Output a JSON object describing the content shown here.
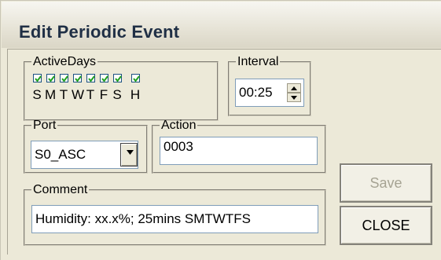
{
  "window": {
    "title": "Edit Periodic Event"
  },
  "active_days": {
    "legend": "ActiveDays",
    "days": [
      {
        "label": "S",
        "checked": true
      },
      {
        "label": "M",
        "checked": true
      },
      {
        "label": "T",
        "checked": true
      },
      {
        "label": "W",
        "checked": true
      },
      {
        "label": "T",
        "checked": true
      },
      {
        "label": "F",
        "checked": true
      },
      {
        "label": "S",
        "checked": true
      },
      {
        "label": "H",
        "checked": true
      }
    ]
  },
  "interval": {
    "legend": "Interval",
    "value": "00:25"
  },
  "port": {
    "legend": "Port",
    "selected": "S0_ASC"
  },
  "action": {
    "legend": "Action",
    "value": "0003"
  },
  "comment": {
    "legend": "Comment",
    "value": "Humidity: xx.x%; 25mins SMTWTFS"
  },
  "buttons": {
    "save": "Save",
    "close": "CLOSE"
  },
  "colors": {
    "title_text": "#1f2f45",
    "dialog_bg": "#ECE9D8",
    "check_mark": "#21A121",
    "disabled_text": "#a6a393"
  }
}
